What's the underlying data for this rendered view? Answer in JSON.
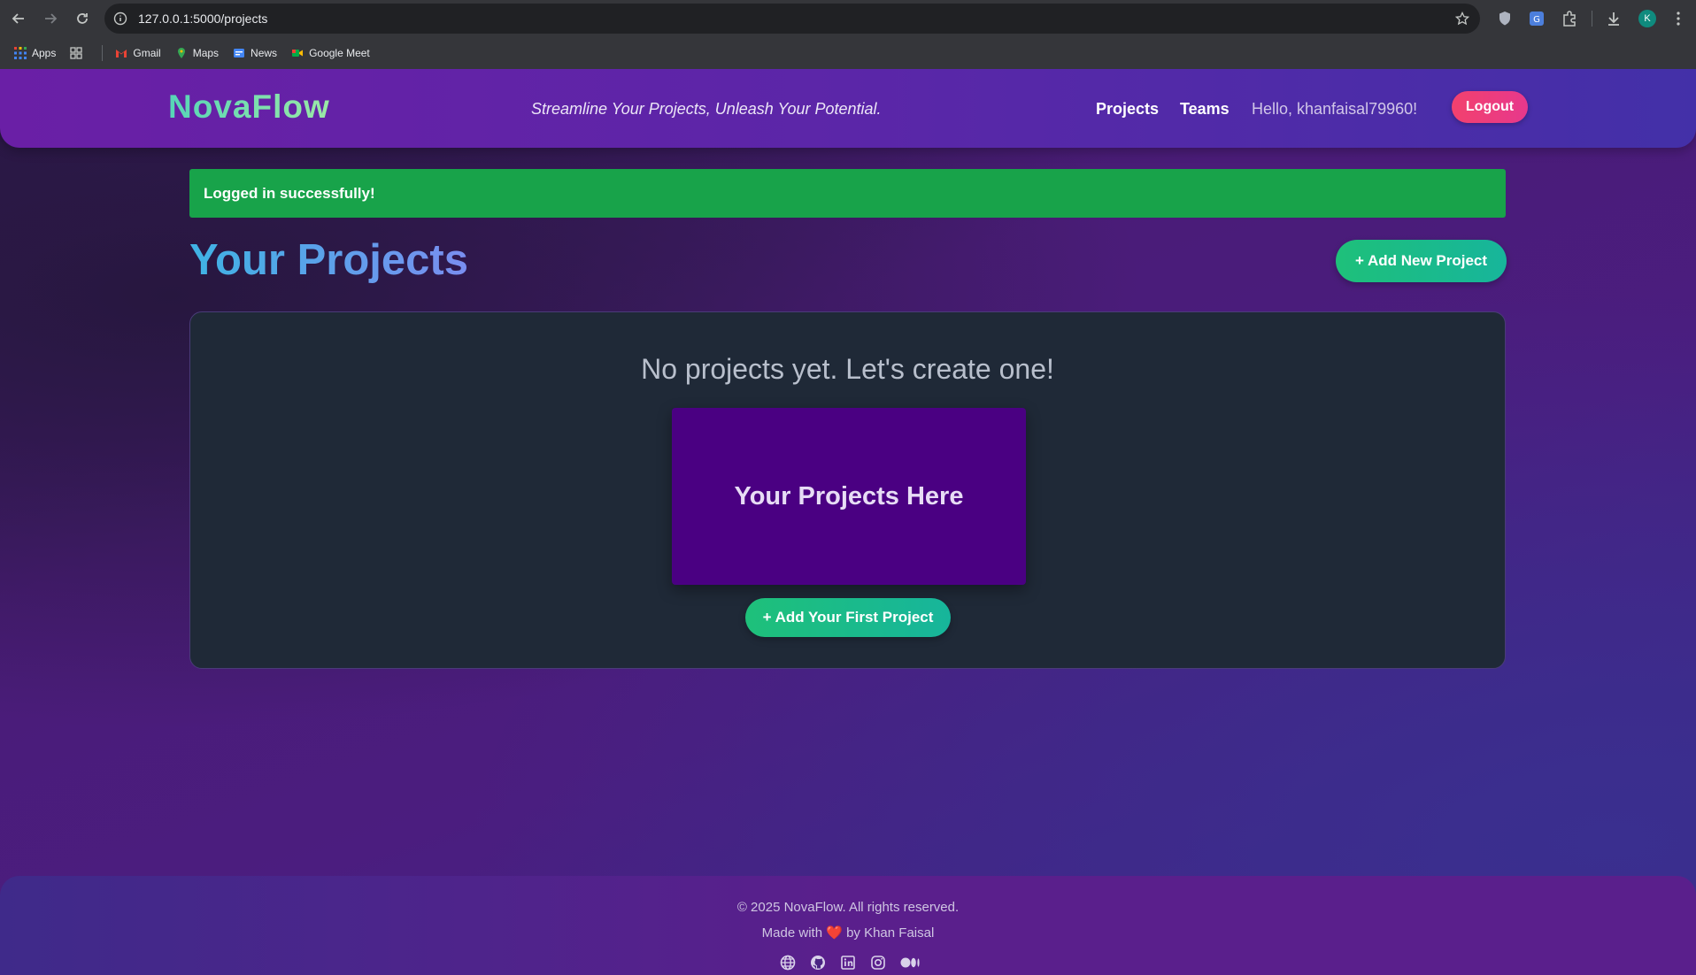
{
  "browser": {
    "url": "127.0.0.1:5000/projects",
    "profile_initial": "K",
    "bookmarks": [
      {
        "label": "Apps"
      },
      {
        "label": "Gmail"
      },
      {
        "label": "Maps"
      },
      {
        "label": "News"
      },
      {
        "label": "Google Meet"
      }
    ]
  },
  "header": {
    "logo": "NovaFlow",
    "tagline": "Streamline Your Projects, Unleash Your Potential.",
    "nav": {
      "projects": "Projects",
      "teams": "Teams"
    },
    "greeting": "Hello, khanfaisal79960!",
    "logout": "Logout"
  },
  "alert": {
    "message": "Logged in successfully!"
  },
  "main": {
    "title": "Your Projects",
    "add_new_label": "+ Add New Project",
    "empty_message": "No projects yet. Let's create one!",
    "placeholder_text": "Your Projects Here",
    "add_first_label": "+ Add Your First Project"
  },
  "footer": {
    "copyright": "© 2025 NovaFlow. All rights reserved.",
    "made_prefix": "Made with",
    "made_suffix": "by Khan Faisal",
    "social_icons": [
      "globe-icon",
      "github-icon",
      "linkedin-icon",
      "instagram-icon",
      "medium-icon"
    ]
  },
  "colors": {
    "alert_success": "#18a34a",
    "logout": "#f2416e",
    "cta": "#1ec07a",
    "panel": "#1f2937",
    "placeholder": "#4a0082"
  }
}
